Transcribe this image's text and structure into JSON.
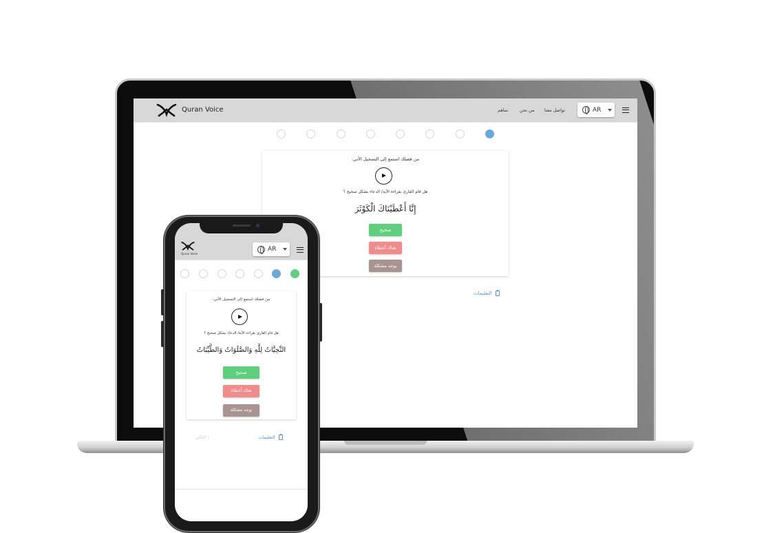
{
  "app": {
    "name": "Quran Voice",
    "short_name": "Quran Voice"
  },
  "navbar": {
    "links": [
      "ساهم",
      "من نحن",
      "تواصل معنا"
    ],
    "language": "AR"
  },
  "laptop": {
    "steps": {
      "total": 8,
      "active_index": 7
    },
    "prompt_listen": "من فضلك استمع إلى التسجيل الآتي:",
    "prompt_question": "هل قام القارئ بقراءة الآية/ الدعاء بشكل صحيح ؟",
    "ayah": "إِنَّا أَعْطَيْنَاكَ الْكَوْثَرَ",
    "buttons": {
      "correct": "صحيح",
      "mistakes": "هناك أخطاء",
      "problem": "يوجد مشكلة"
    },
    "instructions": "التعليمات"
  },
  "phone": {
    "steps": {
      "total": 7,
      "active_index": 5,
      "done_index": 6
    },
    "prompt_listen": "من فضلك استمع إلى التسجيل الآتي:",
    "prompt_question": "هل قام القارئ بقراءة الآية/ الدعاء بشكل صحيح ؟",
    "ayah": "التَّحِيَّاتُ لِلَّهِ وَالصَّلَوَاتُ وَالطَّيِّبَاتُ",
    "buttons": {
      "correct": "صحيح",
      "mistakes": "هناك أخطاء",
      "problem": "يوجد مشكلة"
    },
    "instructions": "التعليمات",
    "next": "التالي"
  }
}
